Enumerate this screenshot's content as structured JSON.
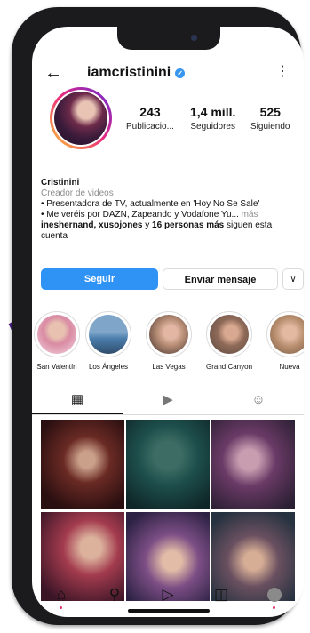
{
  "header": {
    "back_icon": "arrow-left-icon",
    "username": "iamcristinini",
    "verified_icon": "verified-badge-icon",
    "more_icon": "vertical-dots-icon"
  },
  "stats": [
    {
      "value": "243",
      "label": "Publicacio..."
    },
    {
      "value": "1,4 mill.",
      "label": "Seguidores"
    },
    {
      "value": "525",
      "label": "Siguiendo"
    }
  ],
  "bio": {
    "name": "Cristinini",
    "category": "Creador de videos",
    "line1": "• Presentadora de TV, actualmente en 'Hoy No Se Sale'",
    "line2": "• Me veréis por DAZN, Zapeando y Vodafone Yu...",
    "line2_more": " más",
    "followed_by_users": "ineshernand, xusojones",
    "followed_by_mid": " y ",
    "followed_by_count": "16 personas más",
    "followed_by_tail": " siguen esta cuenta"
  },
  "buttons": {
    "follow": "Seguir",
    "message": "Enviar mensaje",
    "more_icon": "chevron-down-icon"
  },
  "highlights": [
    {
      "label": "San Valentín"
    },
    {
      "label": "Los Ángeles"
    },
    {
      "label": "Las Vegas"
    },
    {
      "label": "Grand Canyon"
    },
    {
      "label": "Nueva"
    }
  ],
  "tabs": [
    {
      "icon": "grid-icon",
      "active": true
    },
    {
      "icon": "reels-icon",
      "active": false
    },
    {
      "icon": "tagged-icon",
      "active": false
    }
  ],
  "nav": [
    {
      "icon": "home-icon"
    },
    {
      "icon": "search-icon"
    },
    {
      "icon": "reels-icon"
    },
    {
      "icon": "shop-icon"
    },
    {
      "icon": "profile-avatar-icon"
    }
  ],
  "colors": {
    "accent": "#2f93f5",
    "frame": "#1b1b1d",
    "swoosh": "#4a1f86"
  }
}
